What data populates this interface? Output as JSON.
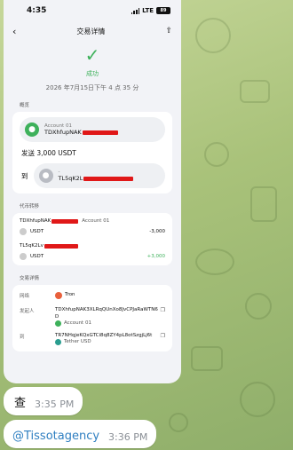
{
  "status_bar": {
    "time": "4:35",
    "network": "LTE",
    "battery": "89"
  },
  "nav": {
    "title": "交易详情",
    "back_icon": "chevron-left-icon",
    "share_icon": "share-icon"
  },
  "result": {
    "status": "成功",
    "date": "2026 年7月15日下午 4 点 35 分"
  },
  "overview": {
    "label": "概览",
    "from_account_name": "Account 01",
    "from_address": "TDXhfupNAK",
    "send_label": "发送",
    "send_amount": "3,000 USDT",
    "to_label": "到",
    "to_name": "-",
    "to_address": "TL5qK2L"
  },
  "transfer": {
    "label": "代币转移",
    "rows": [
      {
        "address": "TDXhfupNAK",
        "account": "Account 01",
        "token": "USDT",
        "amount": "-3,000"
      },
      {
        "address": "TL5qK2Lv",
        "account": "",
        "token": "USDT",
        "amount": "+3,000"
      }
    ]
  },
  "details": {
    "label": "交易详情",
    "network_label": "网络",
    "network_value": "Tron",
    "sender_label": "发起人",
    "sender_address": "TDXhfupNAK3XLRqQUnXo8JvCPJaRaWTN6D",
    "sender_account": "Account 01",
    "receiver_label": "到",
    "receiver_address": "TR7NHqjeKQxGTCi8q8ZY4pL8otSzgjLj6t",
    "receiver_sub": "Tether USD"
  },
  "chat": {
    "message1": "查",
    "time1": "3:35 PM",
    "message2": "@Tissotagency",
    "time2": "3:36 PM"
  },
  "colors": {
    "accent_green": "#3eb15b",
    "redaction": "#e01818",
    "link_blue": "#2f7fc1",
    "wallpaper": "#a9c27a"
  }
}
